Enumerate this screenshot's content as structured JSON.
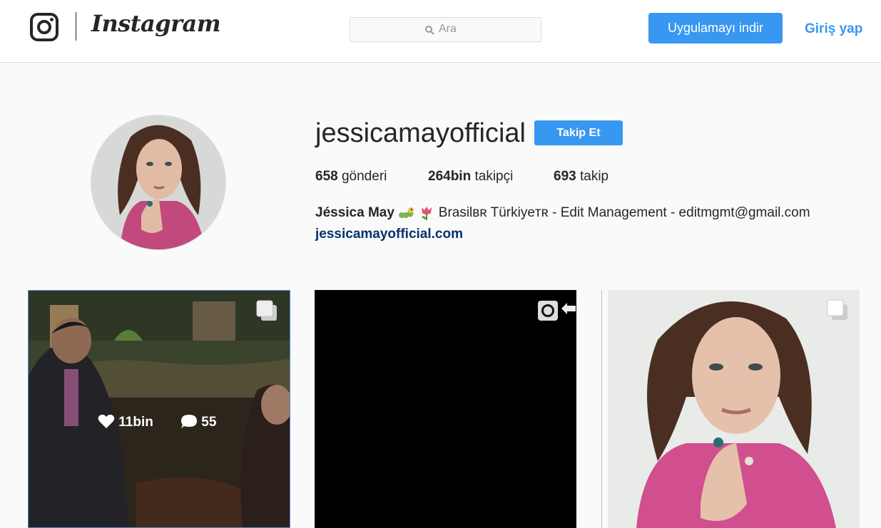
{
  "header": {
    "logo_text": "Instagram",
    "search": {
      "placeholder": "Ara"
    },
    "download_label": "Uygulamayı indir",
    "login_label": "Giriş yap"
  },
  "profile": {
    "username": "jessicamayofficial",
    "follow_label": "Takip Et",
    "stats": {
      "posts_count": "658",
      "posts_label": "gönderi",
      "followers_count": "264bin",
      "followers_label": "takipçi",
      "following_count": "693",
      "following_label": "takip"
    },
    "bio": {
      "name": "Jéssica May",
      "text": "Brasilʙʀ Türkiyeᴛʀ - Edit Management - editmgmt@gmail.com",
      "link": "jessicamayofficial.com"
    }
  },
  "posts": [
    {
      "type": "carousel",
      "likes": "11bin",
      "comments": "55",
      "hovered": true
    },
    {
      "type": "video"
    },
    {
      "type": "carousel"
    }
  ],
  "colors": {
    "accent": "#3897f0",
    "link": "#003569"
  }
}
